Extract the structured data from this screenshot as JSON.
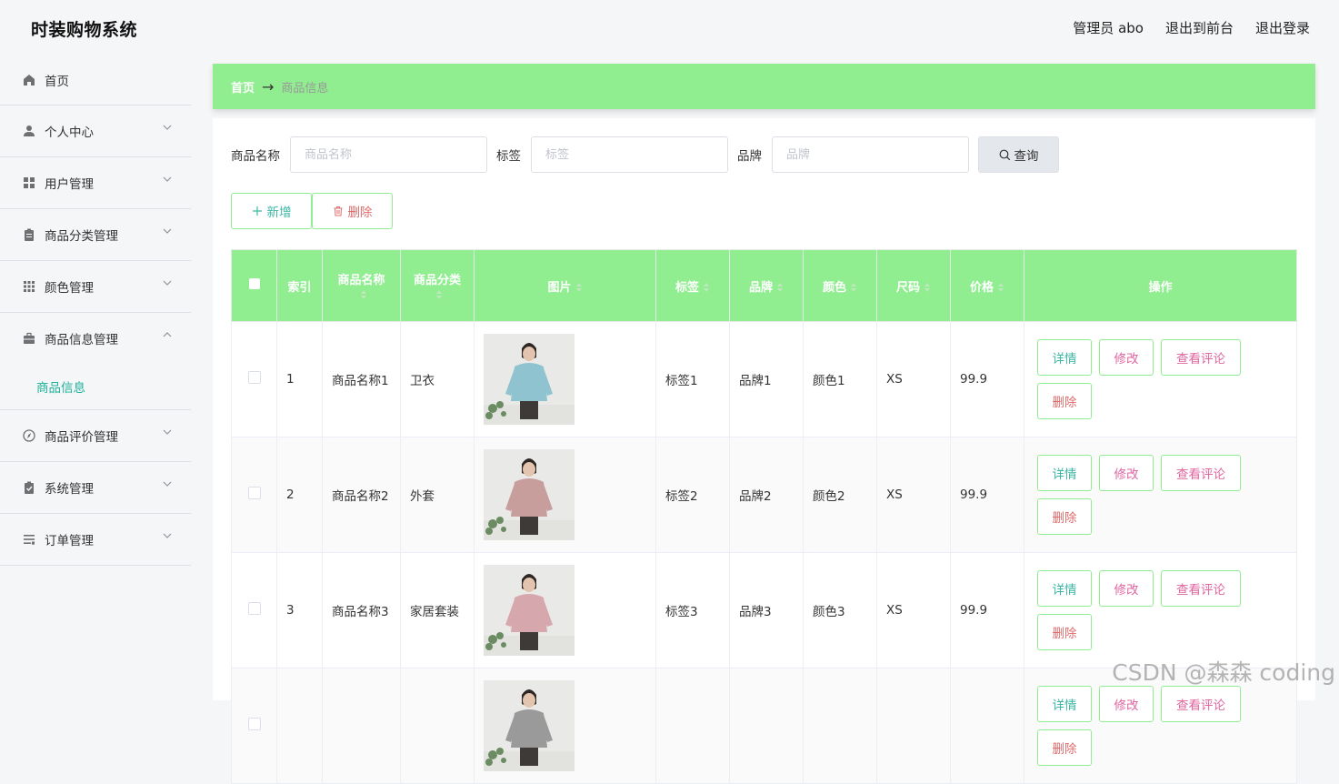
{
  "header": {
    "title": "时装购物系统",
    "admin": "管理员 abo",
    "front": "退出到前台",
    "logout": "退出登录"
  },
  "sidebar": {
    "items": [
      {
        "label": "首页",
        "icon": "home-icon"
      },
      {
        "label": "个人中心",
        "icon": "user-icon"
      },
      {
        "label": "用户管理",
        "icon": "grid-icon"
      },
      {
        "label": "商品分类管理",
        "icon": "clipboard-icon"
      },
      {
        "label": "颜色管理",
        "icon": "apps-icon"
      },
      {
        "label": "商品信息管理",
        "icon": "briefcase-icon",
        "expanded": true
      },
      {
        "label": "商品评价管理",
        "icon": "compass-icon"
      },
      {
        "label": "系统管理",
        "icon": "checklist-icon"
      },
      {
        "label": "订单管理",
        "icon": "list-icon"
      }
    ],
    "sub": {
      "label": "商品信息"
    }
  },
  "breadcrumb": {
    "home": "首页",
    "arrow": "→",
    "current": "商品信息"
  },
  "search": {
    "name_label": "商品名称",
    "name_placeholder": "商品名称",
    "tag_label": "标签",
    "tag_placeholder": "标签",
    "brand_label": "品牌",
    "brand_placeholder": "品牌",
    "query": "查询"
  },
  "actions": {
    "add": "新增",
    "delete": "删除"
  },
  "table": {
    "headers": [
      "索引",
      "商品名称",
      "商品分类",
      "图片",
      "标签",
      "品牌",
      "颜色",
      "尺码",
      "价格",
      "操作"
    ],
    "rows": [
      {
        "idx": "1",
        "name": "商品名称1",
        "category": "卫衣",
        "tag": "标签1",
        "brand": "品牌1",
        "color": "颜色1",
        "size": "XS",
        "price": "99.9",
        "garment": "#8ec3cf"
      },
      {
        "idx": "2",
        "name": "商品名称2",
        "category": "外套",
        "tag": "标签2",
        "brand": "品牌2",
        "color": "颜色2",
        "size": "XS",
        "price": "99.9",
        "garment": "#c79e9c"
      },
      {
        "idx": "3",
        "name": "商品名称3",
        "category": "家居套装",
        "tag": "标签3",
        "brand": "品牌3",
        "color": "颜色3",
        "size": "XS",
        "price": "99.9",
        "garment": "#d7a7ae"
      },
      {
        "idx": "",
        "name": "",
        "category": "",
        "tag": "",
        "brand": "",
        "color": "",
        "size": "",
        "price": "",
        "garment": "#9a9a9a"
      }
    ],
    "ops": {
      "detail": "详情",
      "edit": "修改",
      "review": "查看评论",
      "remove": "删除"
    }
  },
  "watermark": "CSDN @森森 coding",
  "colors": {
    "accent": "#90ee90",
    "teal": "#3cb6a5",
    "pink": "#e066a0",
    "red": "#e06b6b"
  }
}
